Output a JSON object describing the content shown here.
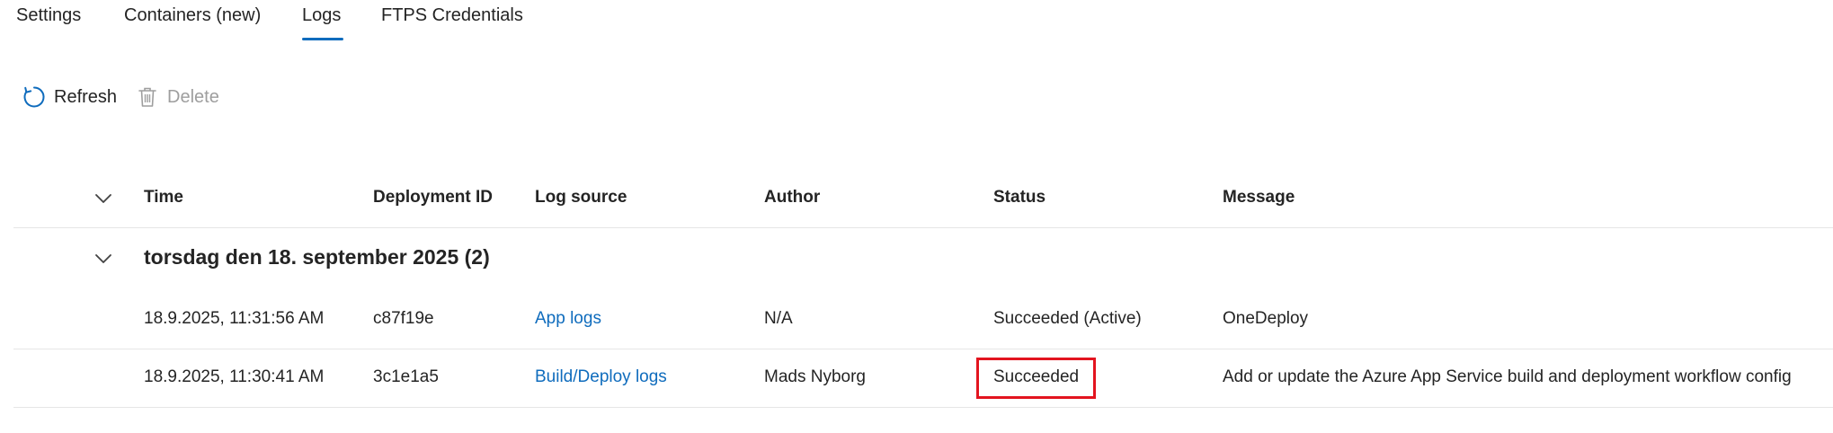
{
  "tabs": [
    {
      "label": "Settings",
      "active": false
    },
    {
      "label": "Containers (new)",
      "active": false
    },
    {
      "label": "Logs",
      "active": true
    },
    {
      "label": "FTPS Credentials",
      "active": false
    }
  ],
  "toolbar": {
    "refresh_label": "Refresh",
    "refresh_icon": "refresh-icon",
    "delete_label": "Delete",
    "delete_icon": "trash-icon",
    "delete_enabled": false
  },
  "table": {
    "columns": [
      "Time",
      "Deployment ID",
      "Log source",
      "Author",
      "Status",
      "Message"
    ],
    "groups": [
      {
        "title": "torsdag den 18. september 2025 (2)",
        "expanded": true,
        "rows": [
          {
            "time": "18.9.2025, 11:31:56 AM",
            "deployment_id": "c87f19e",
            "log_source": "App logs",
            "author": "N/A",
            "status": "Succeeded (Active)",
            "message": "OneDeploy"
          },
          {
            "time": "18.9.2025, 11:30:41 AM",
            "deployment_id": "3c1e1a5",
            "log_source": "Build/Deploy logs",
            "author": "Mads Nyborg",
            "status": "Succeeded",
            "message": "Add or update the Azure App Service build and deployment workflow config",
            "status_highlighted": true
          }
        ]
      }
    ]
  },
  "colors": {
    "accent": "#0f6cbd",
    "highlight": "#e3141f",
    "text": "#242424",
    "disabled": "#9e9e9e",
    "divider": "#e6e6e6"
  }
}
